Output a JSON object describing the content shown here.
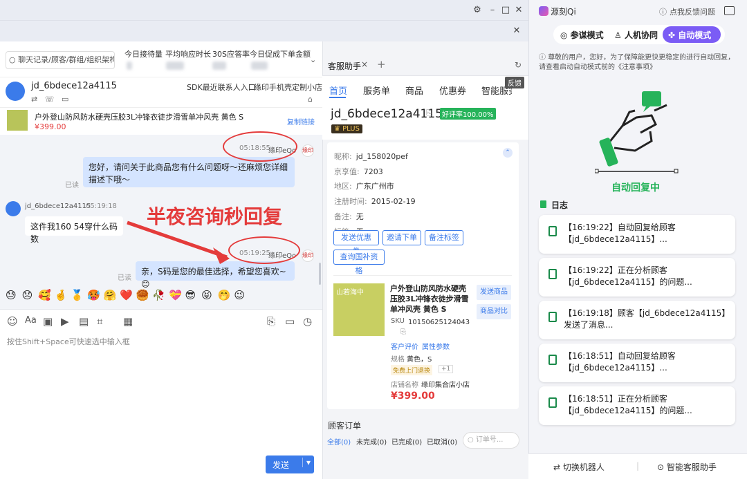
{
  "titlebar": {
    "icons": [
      "settings-icon",
      "minimize-icon",
      "maximize-icon",
      "close-icon"
    ]
  },
  "search": {
    "placeholder": "聊天记录/顾客/群组/组织架构"
  },
  "stats": [
    {
      "label": "今日接待量"
    },
    {
      "label": "平均响应时长"
    },
    {
      "label": "30S应答率"
    },
    {
      "label": "今日促成下单金额"
    }
  ],
  "chat_header": {
    "name": "jd_6bdece12a4115",
    "sdk": "SDK最近联系人入口",
    "shop": "缘印手机壳定制小店"
  },
  "product_banner": {
    "title": "户外登山防风防水硬壳压胶3L冲锋衣徒步滑雪单冲风壳 黄色 S",
    "price": "¥399.00",
    "copy_link": "复制链接"
  },
  "messages": [
    {
      "time": "05:18:55",
      "sender": "缘印eQo",
      "text": "您好，请问关于此商品您有什么问题呀～还麻烦您详细描述下哦～",
      "status": "已读"
    },
    {
      "user": "jd_6bdece12a4115",
      "time": "05:19:18",
      "text": "这件我160 54穿什么码数"
    },
    {
      "time": "05:19:25",
      "sender": "缘印eQo",
      "text": "亲，S码是您的最佳选择，希望您喜欢~😊",
      "status": "已读"
    }
  ],
  "annotation": "半夜咨询秒回复",
  "emojis": [
    "😓",
    "😞",
    "🥰",
    "🤞",
    "🥇",
    "🥵",
    "🤗",
    "❤️",
    "🥮",
    "🥀",
    "💝",
    "😎",
    "😝",
    "🤭",
    "😉"
  ],
  "input": {
    "placeholder": "按住Shift+Space可快速选中输入框"
  },
  "send": {
    "label": "发送",
    "arrow": "▾"
  },
  "assistant": {
    "tab_label": "客服助手",
    "tab_close": "×",
    "tab_add": "+",
    "tabs": [
      "首页",
      "服务单",
      "商品",
      "优惠券",
      "智能服务"
    ],
    "feedback": "反馈",
    "customer": {
      "name": "jd_6bdece12a4115",
      "rating": "好评率100.00%",
      "plus": "PLUS",
      "fields": [
        {
          "k": "昵称:",
          "v": "jd_158020pef"
        },
        {
          "k": "京享值:",
          "v": "7203"
        },
        {
          "k": "地区:",
          "v": "广东广州市"
        },
        {
          "k": "注册时间:",
          "v": "2015-02-19"
        },
        {
          "k": "备注:",
          "v": "无"
        },
        {
          "k": "标签:",
          "v": "无"
        }
      ]
    },
    "buttons": [
      "发送优惠券",
      "邀请下单",
      "备注标签",
      "查询国补资格"
    ],
    "product": {
      "title": "户外登山防风防水硬壳压胶3L冲锋衣徒步滑雪单冲风壳 黄色 S",
      "img_label": "山若海中",
      "sku_label": "SKU",
      "sku": "10150625124043",
      "review": "客户评价",
      "params": "属性参数",
      "spec_label": "规格",
      "spec": "黄色，S",
      "tag": "免费上门退换",
      "tag_more": "+1",
      "shop_label": "店铺名称",
      "shop": "缘印集合店小店",
      "price": "¥399.00",
      "send": "发送商品",
      "compare": "商品对比"
    },
    "orders": {
      "title": "顾客订单",
      "filters": [
        "全部(0)",
        "未完成(0)",
        "已完成(0)",
        "已取消(0)"
      ],
      "placeholder": "订单号..."
    }
  },
  "ai": {
    "logo": "源刻Qi",
    "feedback": "点我反馈问题",
    "modes": [
      "参谋模式",
      "人机协同",
      "自动模式"
    ],
    "notice": "尊敬的用户，您好，为了保障能更快更稳定的进行自动回复，请查看启动自动模式前的《注意事项》",
    "status": "自动回复中",
    "log_title": "日志",
    "logs": [
      "【16:19:22】自动回复给顾客【jd_6bdece12a4115】...",
      "【16:19:22】正在分析顾客【jd_6bdece12a4115】的问题...",
      "【16:19:18】顾客【jd_6bdece12a4115】发送了消息...",
      "【16:18:51】自动回复给顾客【jd_6bdece12a4115】...",
      "【16:18:51】正在分析顾客【jd_6bdece12a4115】的问题..."
    ],
    "switch": "切换机器人",
    "assistant": "智能客服助手"
  },
  "colors": {
    "accent": "#3b7bea",
    "green": "#1a8a4a",
    "red": "#e43b3b",
    "purple": "#7b5cf5"
  }
}
